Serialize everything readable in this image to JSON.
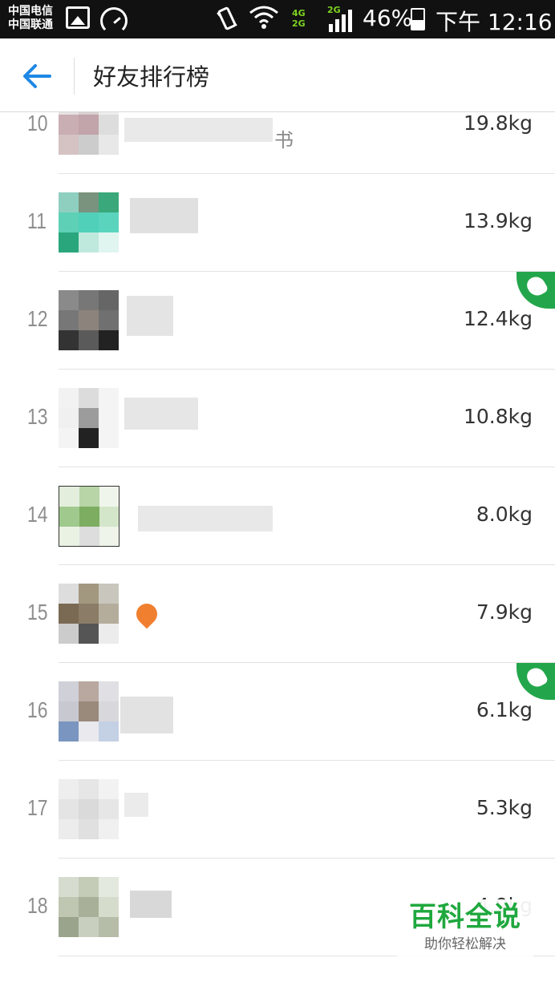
{
  "status_bar": {
    "carrier_1": "中国电信",
    "carrier_2": "中国联通",
    "network_1": "4G",
    "network_2": "2G",
    "network_3": "2G",
    "battery": "46%",
    "time": "下午 12:16",
    "icons": [
      "image-icon",
      "speedometer-icon",
      "vibrate-icon",
      "wifi-icon",
      "signal-icon",
      "battery-icon"
    ]
  },
  "header": {
    "title": "好友排行榜",
    "back_icon": "arrow-left-icon",
    "accent": "#1e88e5"
  },
  "ranking": [
    {
      "rank": "10",
      "name": "书",
      "weight": "19.8kg",
      "liked": false
    },
    {
      "rank": "11",
      "name": "",
      "weight": "13.9kg",
      "liked": false
    },
    {
      "rank": "12",
      "name": "",
      "weight": "12.4kg",
      "liked": true
    },
    {
      "rank": "13",
      "name": "",
      "weight": "10.8kg",
      "liked": false
    },
    {
      "rank": "14",
      "name": "",
      "weight": "8.0kg",
      "liked": false
    },
    {
      "rank": "15",
      "name": "",
      "weight": "7.9kg",
      "liked": false
    },
    {
      "rank": "16",
      "name": "",
      "weight": "6.1kg",
      "liked": true
    },
    {
      "rank": "17",
      "name": "",
      "weight": "5.3kg",
      "liked": false
    },
    {
      "rank": "18",
      "name": "",
      "weight": "4.9kg",
      "liked": false
    }
  ],
  "watermark": {
    "main": "百科全说",
    "sub": "助你轻松解决",
    "color": "#1fa83e"
  },
  "like_color": "#23a64b"
}
